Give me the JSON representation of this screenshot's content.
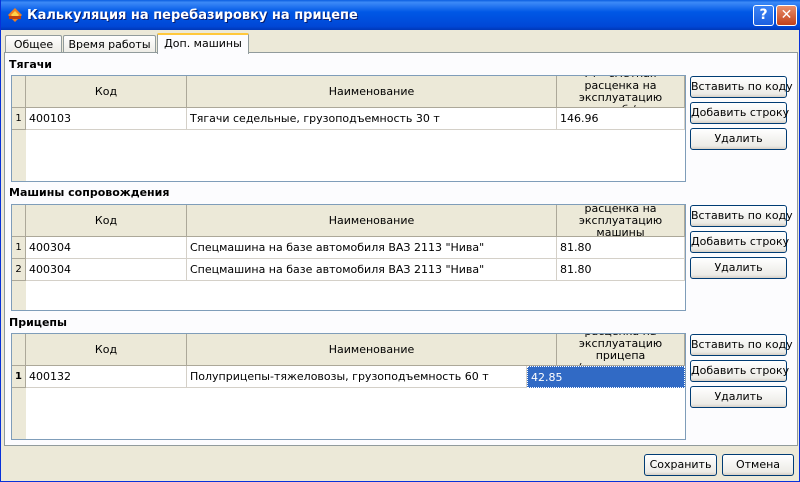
{
  "window": {
    "title": "Калькуляция на перебазировку на прицепе",
    "help_glyph": "?",
    "close_glyph": "✕"
  },
  "tabs": [
    {
      "label": "Общее"
    },
    {
      "label": "Время работы"
    },
    {
      "label": "Доп. машины"
    }
  ],
  "sections": [
    {
      "title": "Тягачи",
      "columns": [
        "Код",
        "Наименование",
        "Рт - сметная расценка на эксплуатацию тягача, руб./маш.-ч;"
      ],
      "rows": [
        {
          "num": "1",
          "code": "400103",
          "name": "Тягачи седельные, грузоподъемность 30 т",
          "rate": "146.96"
        }
      ],
      "buttons": {
        "insert": "Вставить по коду",
        "add": "Добавить строку",
        "delete": "Удалить"
      }
    },
    {
      "title": "Машины сопровождения",
      "columns": [
        "Код",
        "Наименование",
        "Рмс - сметная расценка на эксплуатацию машины сопровождения,"
      ],
      "rows": [
        {
          "num": "1",
          "code": "400304",
          "name": "Спецмашина на базе автомобиля ВАЗ 2113 \"Нива\"",
          "rate": "81.80"
        },
        {
          "num": "2",
          "code": "400304",
          "name": "Спецмашина на базе автомобиля ВАЗ 2113 \"Нива\"",
          "rate": "81.80"
        }
      ],
      "buttons": {
        "insert": "Вставить по коду",
        "add": "Добавить строку",
        "delete": "Удалить"
      }
    },
    {
      "title": "Прицепы",
      "columns": [
        "Код",
        "Наименование",
        "Рпр - сметная расценка на эксплуатацию прицепа (полуприцепа, прицепа-"
      ],
      "rows": [
        {
          "num": "1",
          "code": "400132",
          "name": "Полуприцепы-тяжеловозы, грузоподъемность 60 т",
          "rate": "42.85"
        }
      ],
      "buttons": {
        "insert": "Вставить по коду",
        "add": "Добавить строку",
        "delete": "Удалить"
      }
    }
  ],
  "footer": {
    "save": "Сохранить",
    "cancel": "Отмена"
  }
}
